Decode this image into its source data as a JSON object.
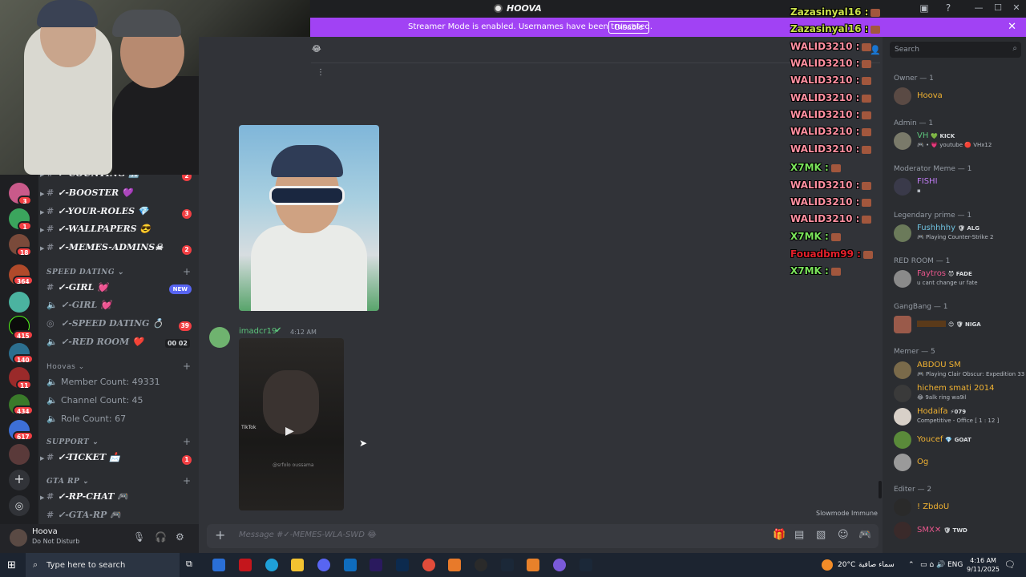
{
  "window": {
    "title": "HOOVA"
  },
  "banner": {
    "text": "Streamer Mode is enabled. Usernames have been truncated.",
    "button": "Disable",
    "close": "✕"
  },
  "rail_badges": [
    "3",
    "1",
    "18",
    "364",
    "415",
    "140",
    "11",
    "434",
    "617"
  ],
  "sidebar": {
    "channels_top": [
      {
        "label": "✓-COUNTING 🔢",
        "badge": "2"
      },
      {
        "label": "✓-BOOSTER 💜",
        "badge": ""
      },
      {
        "label": "✓-YOUR-ROLES 💎",
        "badge": "3"
      },
      {
        "label": "✓-WALLPAPERS 😎",
        "badge": ""
      },
      {
        "label": "✓-MEMES-ADMINS☠",
        "badge": "2"
      }
    ],
    "cat_speed": "SPEED DATING ⌄",
    "speed_channels": [
      {
        "label": "✓-GIRL 💓",
        "badge": "NEW"
      },
      {
        "label": "✓-GIRL 💓",
        "badge": ""
      },
      {
        "label": "✓-SPEED DATING 💍",
        "badge": "39"
      },
      {
        "label": "✓-RED ROOM ❤️",
        "badge": "00 02"
      }
    ],
    "cat_hoovas": "Hoovas ⌄",
    "stats": [
      "Member Count: 49331",
      "Channel Count: 45",
      "Role Count: 67"
    ],
    "cat_support": "SUPPORT ⌄",
    "ticket": {
      "label": "✓-TICKET 📩",
      "badge": "1"
    },
    "cat_gta": "GTA RP ⌄",
    "gta_channels": [
      "✓-RP-CHAT 🎮",
      "✓-GTA-RP 🎮"
    ]
  },
  "user": {
    "name": "Hoova",
    "status": "Do Not Disturb"
  },
  "chat": {
    "author": "imadcr19",
    "time": "4:12 AM",
    "video_tiktok": "TikTok",
    "video_caption": "@srfolo oussama",
    "slowmode": "Slowmode Immune",
    "placeholder": "Message #✓-MEMES-WLA-SWD 😂"
  },
  "overlay": [
    {
      "name": "Zazasinyal16 :",
      "color": "#c9e04a"
    },
    {
      "name": "Zazasinyal16 :",
      "color": "#c9e04a"
    },
    {
      "name": "WALID3210 :",
      "color": "#ff8fa0"
    },
    {
      "name": "WALID3210 :",
      "color": "#ff8fa0"
    },
    {
      "name": "WALID3210 :",
      "color": "#ff8fa0"
    },
    {
      "name": "WALID3210 :",
      "color": "#ff8fa0"
    },
    {
      "name": "WALID3210 :",
      "color": "#ff8fa0"
    },
    {
      "name": "WALID3210 :",
      "color": "#ff8fa0"
    },
    {
      "name": "WALID3210 :",
      "color": "#ff8fa0"
    },
    {
      "name": "X7MK :",
      "color": "#7ae35a"
    },
    {
      "name": "WALID3210 :",
      "color": "#ff8fa0"
    },
    {
      "name": "WALID3210 :",
      "color": "#ff8fa0"
    },
    {
      "name": "WALID3210 :",
      "color": "#ff8fa0"
    },
    {
      "name": "X7MK :",
      "color": "#7ae35a"
    },
    {
      "name": "Fouadbm99 :",
      "color": "#e3202b"
    },
    {
      "name": "X7MK :",
      "color": "#7ae35a"
    }
  ],
  "members": {
    "search_placeholder": "Search",
    "roles": [
      "Owner — 1",
      "Admin — 1",
      "Moderator Meme — 1",
      "Legendary prime — 1",
      "RED ROOM — 1",
      "GangBang — 1",
      "Memer — 5",
      "Editer — 2"
    ],
    "list": [
      {
        "name": "Hoova",
        "sub": "",
        "tag": "",
        "color": "#f0b232"
      },
      {
        "name": "VH",
        "sub": "🎮 • 💗 youtube 🔴 VHx12",
        "tag": "💚 KICK",
        "color": "#5cc57c"
      },
      {
        "name": "FISHI",
        "sub": "▪",
        "tag": "",
        "color": "#c07cf5"
      },
      {
        "name": "Fushhhhy",
        "sub": "🎮 Playing Counter-Strike 2",
        "tag": "🛡 ALG",
        "color": "#6fc2e0"
      },
      {
        "name": "Faytros",
        "sub": "u cant change ur fate",
        "tag": "😈 FADE",
        "color": "#e8568c"
      },
      {
        "name": "",
        "sub": "",
        "tag": "😊 🛡 NIGA",
        "color": "#f0b232"
      },
      {
        "name": "ABDOU SM",
        "sub": "🎮 Playing Clair Obscur: Expedition 33",
        "tag": "",
        "color": "#f0b232"
      },
      {
        "name": "hichem smati 2014",
        "sub": "😂 9alk ring wa9il",
        "tag": "",
        "color": "#f0b232"
      },
      {
        "name": "Hodaifa",
        "sub": "Competitive - Office [ 1 : 12 ]",
        "tag": "⚡079",
        "color": "#f0b232"
      },
      {
        "name": "Youcef",
        "sub": "",
        "tag": "💎 GOAT",
        "color": "#f0b232"
      },
      {
        "name": "Og",
        "sub": "",
        "tag": "",
        "color": "#f0b232"
      },
      {
        "name": "! ZbdoU",
        "sub": "",
        "tag": "",
        "color": "#f0b232"
      },
      {
        "name": "SMX✕",
        "sub": "",
        "tag": "🛡 TWD",
        "color": "#e8568c"
      }
    ]
  },
  "taskbar": {
    "search_placeholder": "Type here to search",
    "weather": "20°C",
    "weather_text": "سماء صافية",
    "lang": "ENG",
    "time": "4:16 AM",
    "date": "9/11/2025"
  }
}
